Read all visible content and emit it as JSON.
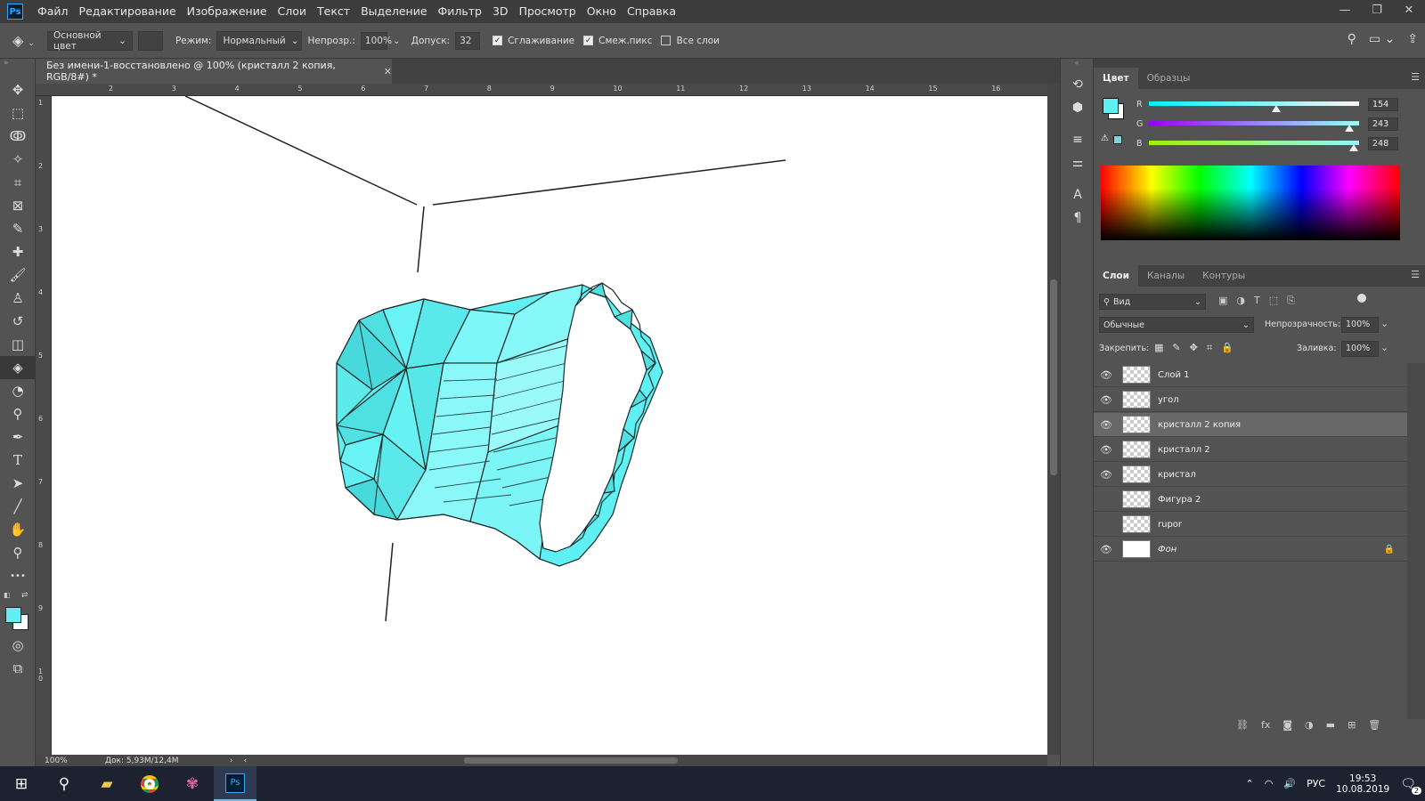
{
  "app": {
    "logo": "Ps"
  },
  "menu": [
    "Файл",
    "Редактирование",
    "Изображение",
    "Слои",
    "Текст",
    "Выделение",
    "Фильтр",
    "3D",
    "Просмотр",
    "Окно",
    "Справка"
  ],
  "window_controls": {
    "minimize": "—",
    "restore": "❐",
    "close": "✕"
  },
  "options": {
    "fill_source": "Основной цвет",
    "mode_label": "Режим:",
    "mode_value": "Нормальный",
    "opacity_label": "Непрозр.:",
    "opacity_value": "100%",
    "tolerance_label": "Допуск:",
    "tolerance_value": "32",
    "antialias_label": "Сглаживание",
    "contiguous_label": "Смеж.пикс",
    "all_layers_label": "Все слои",
    "antialias_checked": true,
    "contiguous_checked": true,
    "all_layers_checked": false
  },
  "document": {
    "tab_title": "Без имени-1-восстановлено @ 100% (кристалл 2 копия, RGB/8#) *",
    "tab_close": "✕",
    "ruler_top": [
      "2",
      "3",
      "4",
      "5",
      "6",
      "7",
      "8",
      "9",
      "10",
      "11",
      "12",
      "13",
      "14",
      "15",
      "16"
    ],
    "ruler_left": [
      "1",
      "2",
      "3",
      "4",
      "5",
      "6",
      "7",
      "8",
      "9",
      "1 0"
    ],
    "zoom": "100%",
    "doc_info": "Док: 5,93M/12,4M",
    "fill_color": "#5ef0f2"
  },
  "tools": [
    {
      "name": "move-tool",
      "glyph": "✥"
    },
    {
      "name": "marquee-tool",
      "glyph": "⬚"
    },
    {
      "name": "lasso-tool",
      "glyph": "ↂ"
    },
    {
      "name": "magic-wand-tool",
      "glyph": "✧"
    },
    {
      "name": "crop-tool",
      "glyph": "⌗"
    },
    {
      "name": "frame-tool",
      "glyph": "⊠"
    },
    {
      "name": "eyedropper-tool",
      "glyph": "✎"
    },
    {
      "name": "healing-tool",
      "glyph": "✚"
    },
    {
      "name": "brush-tool",
      "glyph": "🖌"
    },
    {
      "name": "stamp-tool",
      "glyph": "♙"
    },
    {
      "name": "history-brush-tool",
      "glyph": "↺"
    },
    {
      "name": "eraser-tool",
      "glyph": "◫"
    },
    {
      "name": "paint-bucket-tool",
      "glyph": "◈"
    },
    {
      "name": "blur-tool",
      "glyph": "◔"
    },
    {
      "name": "dodge-tool",
      "glyph": "⚲"
    },
    {
      "name": "pen-tool",
      "glyph": "✒"
    },
    {
      "name": "type-tool",
      "glyph": "T"
    },
    {
      "name": "path-select-tool",
      "glyph": "➤"
    },
    {
      "name": "line-tool",
      "glyph": "╱"
    },
    {
      "name": "hand-tool",
      "glyph": "✋"
    },
    {
      "name": "zoom-tool",
      "glyph": "⚲"
    },
    {
      "name": "more-tools",
      "glyph": "•••"
    }
  ],
  "color_panel": {
    "tabs": [
      "Цвет",
      "Образцы"
    ],
    "foreground": "#5ef0f2",
    "channels": [
      {
        "label": "R",
        "value": "154"
      },
      {
        "label": "G",
        "value": "243"
      },
      {
        "label": "B",
        "value": "248"
      }
    ]
  },
  "layers_panel": {
    "tabs": [
      "Слои",
      "Каналы",
      "Контуры"
    ],
    "filter_label": "Вид",
    "blend_mode": "Обычные",
    "opacity_label": "Непрозрачность:",
    "opacity_value": "100%",
    "lock_label": "Закрепить:",
    "fill_label": "Заливка:",
    "fill_value": "100%",
    "layers": [
      {
        "name": "Слой 1",
        "visible": true,
        "selected": false
      },
      {
        "name": "угол",
        "visible": true,
        "selected": false
      },
      {
        "name": "кристалл 2 копия",
        "visible": true,
        "selected": true
      },
      {
        "name": "кристалл 2",
        "visible": true,
        "selected": false
      },
      {
        "name": "кристал",
        "visible": true,
        "selected": false
      },
      {
        "name": "Фигура 2",
        "visible": false,
        "selected": false
      },
      {
        "name": "rupor",
        "visible": false,
        "selected": false
      },
      {
        "name": "Фон",
        "visible": true,
        "selected": false,
        "locked": true
      }
    ]
  },
  "taskbar": {
    "time": "19:53",
    "date": "10.08.2019",
    "lang": "РУС",
    "notifications": "2"
  }
}
